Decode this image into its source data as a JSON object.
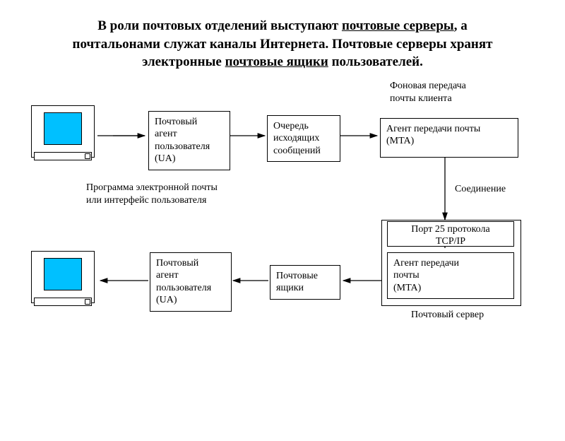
{
  "title_parts": {
    "p1": "В роли почтовых отделений выступают ",
    "u1": "почтовые серверы",
    "p2": ", а почтальонами служат каналы Интернета. Почтовые серверы хранят электронные ",
    "u2": "почтовые ящики",
    "p3": " пользователей."
  },
  "nodes": {
    "ua1": "Почтовый\nагент\nпользователя\n(UA)",
    "queue": "Очередь\nисходящих\nсообщений",
    "mta1": "Агент передачи почты\n(MTA)",
    "port25": "Порт 25 протокола\nTCP/IP",
    "mta2": "Агент передачи\nпочты\n(MTA)",
    "mailbox": "Почтовые\nящики",
    "ua2": "Почтовый\nагент\nпользователя\n(UA)"
  },
  "labels": {
    "bg_transfer": "Фоновая передача\nпочты клиента",
    "client_prog": "Программа электронной почты\nили интерфейс пользователя",
    "connection": "Соединение",
    "server": "Почтовый сервер"
  }
}
